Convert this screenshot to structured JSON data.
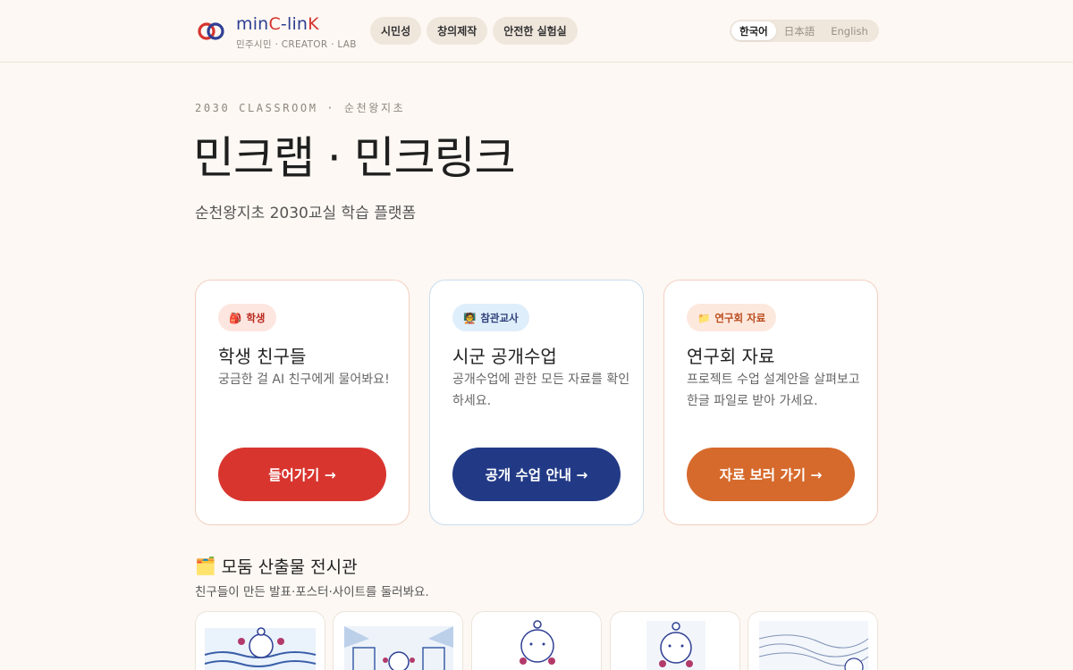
{
  "header": {
    "logo_parts": [
      "min",
      "C",
      "-",
      "lin",
      "K"
    ],
    "logo_subtitle": "민주시민 · CREATOR · LAB",
    "nav": [
      "시민성",
      "창의제작",
      "안전한 실험실"
    ],
    "languages": [
      "한국어",
      "日本語",
      "English"
    ],
    "active_language": "한국어"
  },
  "hero": {
    "eyebrow": "2030 CLASSROOM · 순천왕지초",
    "title": "민크랩 · 민크링크",
    "subtitle": "순천왕지초 2030교실 학습 플랫폼"
  },
  "cards": [
    {
      "badge_icon": "🎒",
      "badge": "학생",
      "title": "학생 친구들",
      "desc": "궁금한 걸 AI 친구에게 물어봐요!",
      "button": "들어가기 →",
      "accent": "#d9352f"
    },
    {
      "badge_icon": "🧑‍🏫",
      "badge": "참관교사",
      "title": "시군 공개수업",
      "desc": "공개수업에 관한 모든 자료를 확인하세요.",
      "button": "공개 수업 안내 →",
      "accent": "#223a86"
    },
    {
      "badge_icon": "📁",
      "badge": "연구회 자료",
      "title": "연구회 자료",
      "desc": "프로젝트 수업 설계안을 살펴보고 한글 파일로 받아 가세요.",
      "button": "자료 보러 가기 →",
      "accent": "#d66a2c"
    }
  ],
  "gallery": {
    "icon": "🗂️",
    "title": "모둠 산출물 전시관",
    "subtitle": "친구들이 만든 발표·포스터·사이트를 둘러봐요."
  }
}
